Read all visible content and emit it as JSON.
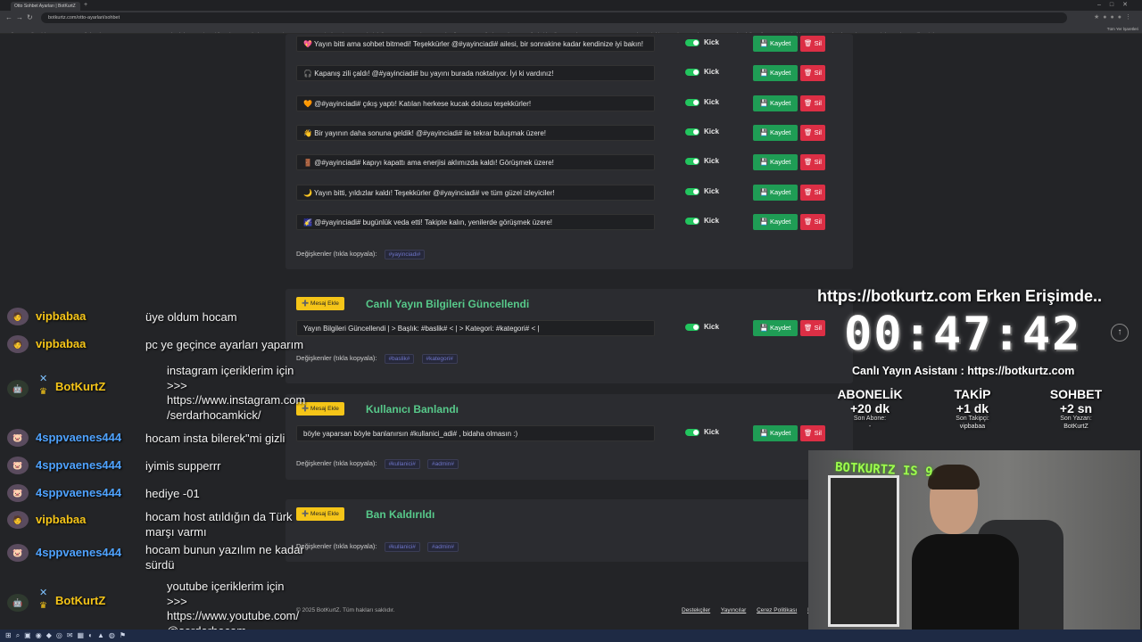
{
  "browser": {
    "tab_title": "Otto Sohbet Ayarları | BotKurtZ",
    "url": "botkurtz.com/otto-ayarlari/sohbet",
    "bookmarks": [
      "Reading",
      "yugali",
      "Kick",
      "YT",
      "Mozen",
      "Nailed Reply",
      "Emoman-TE",
      "PHOTOSHOP",
      "Cyberchef",
      "Enterprise Mobile",
      "Skymerem - The be...",
      "OneDrive - Copy B...",
      "Capacitor by Ionic",
      "Osmantek Kimbeli ...",
      "Squarespace Birme...",
      "Sunday Album-Drum...",
      "TikTok LIVE Chat Ba...",
      "TikTok Video Likes B...",
      "Flutter",
      "DOLU T.1",
      "TENS",
      "Deploy",
      "Wirebit",
      "Free-Zips",
      "Google Genome ...",
      "Google Takeli Metrik",
      "Dropser",
      "Cinebita",
      "IOS",
      "Sesgul Medya Araçla...",
      "Tüm Windows 7.1/10...",
      "Diğer Windows Sür..."
    ],
    "bookmarks_right": "Tüm Yer İşaretleri"
  },
  "messages": [
    {
      "emoji": "💖",
      "text": "Yayın bitti ama sohbet bitmedi! Teşekkürler @#yayinciadi# ailesi, bir sonrakine kadar kendinize iyi bakın!"
    },
    {
      "emoji": "🎧",
      "text": "Kapanış zili çaldı! @#yayinciadi# bu yayını burada noktalıyor. İyi ki vardınız!"
    },
    {
      "emoji": "🧡",
      "text": "@#yayinciadi# çıkış yaptı! Katılan herkese kucak dolusu teşekkürler!"
    },
    {
      "emoji": "👋",
      "text": "Bir yayının daha sonuna geldik! @#yayinciadi# ile tekrar buluşmak üzere!"
    },
    {
      "emoji": "🚪",
      "text": "@#yayinciadi# kapıyı kapattı ama enerjisi aklımızda kaldı! Görüşmek üzere!"
    },
    {
      "emoji": "🌙",
      "text": "Yayın bitti, yıldızlar kaldı! Teşekkürler @#yayinciadi# ve tüm güzel izleyiciler!"
    },
    {
      "emoji": "🌠",
      "text": "@#yayinciadi# bugünlük veda etti! Takipte kalın, yenilerde görüşmek üzere!"
    }
  ],
  "common": {
    "platform": "Kick",
    "save_label": "💾 Kaydet",
    "delete_label": "🗑 Sil",
    "add_label": "➕ Mesaj Ekle",
    "vars_label": "Değişkenler (tıkla kopyala):"
  },
  "section0": {
    "vars": [
      "#yayinciadi#"
    ]
  },
  "section1": {
    "title": "Canlı Yayın Bilgileri Güncellendi",
    "message": "Yayın Bilgileri Güncellendi | > Başlık: #baslik# < | > Kategori: #kategori# < |",
    "vars": [
      "#baslik#",
      "#kategori#"
    ]
  },
  "section2": {
    "title": "Kullanıcı Banlandı",
    "message": "böyle yaparsan böyle banlanırsın #kullanici_adi# , bidaha olmasın :)",
    "vars": [
      "#kullanici#",
      "#admin#"
    ]
  },
  "section3": {
    "title": "Ban Kaldırıldı",
    "vars": [
      "#kullanici#",
      "#admin#"
    ]
  },
  "footer": {
    "copyright": "© 2025 BotKurtZ. Tüm hakları saklıdır.",
    "links": [
      "Destekçiler",
      "Yayıncılar",
      "Çerez Politikası",
      "K"
    ]
  },
  "chat": [
    {
      "user": "vipbabaa",
      "color": "#f5c518",
      "msg": "üye oldum hocam"
    },
    {
      "user": "vipbabaa",
      "color": "#f5c518",
      "msg": "pc ye geçince ayarları yaparım"
    },
    {
      "user": "BotKurtZ",
      "color": "#f5c518",
      "msg_lines": [
        "instagram içeriklerim için",
        ">>>",
        "https://www.instagram.com",
        "/serdarhocamkick/"
      ]
    },
    {
      "user": "4sppvaenes444",
      "color": "#4fa3ff",
      "msg": "hocam insta bilerek\"mi gizli"
    },
    {
      "user": "4sppvaenes444",
      "color": "#4fa3ff",
      "msg": "iyimis supperrr"
    },
    {
      "user": "4sppvaenes444",
      "color": "#4fa3ff",
      "msg": "hediye -01"
    },
    {
      "user": "vipbabaa",
      "color": "#f5c518",
      "msg_lines": [
        "hocam host atıldığın da Türk",
        "marşı varmı"
      ]
    },
    {
      "user": "4sppvaenes444",
      "color": "#4fa3ff",
      "msg_lines": [
        "hocam bunun yazılım ne kadar",
        "sürdü"
      ]
    },
    {
      "user": "BotKurtZ",
      "color": "#f5c518",
      "msg_lines": [
        "youtube içeriklerim için",
        ">>>",
        "https://www.youtube.com/",
        "@serdarhocam"
      ]
    }
  ],
  "overlay": {
    "url_text": "https://botkurtz.com Erken Erişimde..",
    "timer": "00:47:42",
    "assistant": "Canlı Yayın Asistanı : https://botkurtz.com",
    "stats": [
      {
        "label": "ABONELİK",
        "value": "+20 dk",
        "sub": "Son Abone:",
        "who": "-"
      },
      {
        "label": "TAKİP",
        "value": "+1 dk",
        "sub": "Son Takipçi:",
        "who": "vipbabaa"
      },
      {
        "label": "SOHBET",
        "value": "+2 sn",
        "sub": "Son Yazan:",
        "who": "BotKurtZ"
      }
    ],
    "cam_text": "BOTKURTZ IS 9"
  }
}
